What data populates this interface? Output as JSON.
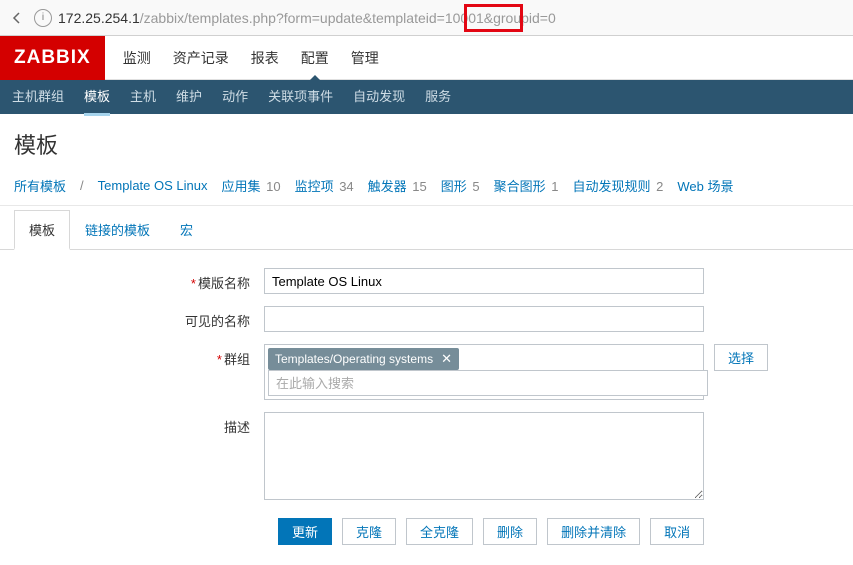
{
  "url": {
    "host": "172.25.254.1",
    "path": "/zabbix/templates.php?form=update&templateid=10001&groupid=0"
  },
  "logo": "ZABBIX",
  "topnav": [
    "监测",
    "资产记录",
    "报表",
    "配置",
    "管理"
  ],
  "topnav_active": 3,
  "subnav": [
    "主机群组",
    "模板",
    "主机",
    "维护",
    "动作",
    "关联项事件",
    "自动发现",
    "服务"
  ],
  "subnav_active": 1,
  "page_title": "模板",
  "filter": {
    "all_label": "所有模板",
    "current": "Template OS Linux",
    "items": [
      {
        "label": "应用集",
        "count": 10
      },
      {
        "label": "监控项",
        "count": 34
      },
      {
        "label": "触发器",
        "count": 15
      },
      {
        "label": "图形",
        "count": 5
      },
      {
        "label": "聚合图形",
        "count": 1
      },
      {
        "label": "自动发现规则",
        "count": 2
      },
      {
        "label": "Web 场景",
        "count": ""
      }
    ]
  },
  "tabs": [
    "模板",
    "链接的模板",
    "宏"
  ],
  "tabs_active": 0,
  "form": {
    "name_label": "模版名称",
    "name_value": "Template OS Linux",
    "visible_label": "可见的名称",
    "visible_value": "",
    "groups_label": "群组",
    "groups_chip": "Templates/Operating systems",
    "groups_placeholder": "在此输入搜索",
    "select_btn": "选择",
    "desc_label": "描述",
    "desc_value": ""
  },
  "buttons": {
    "update": "更新",
    "clone": "克隆",
    "fullclone": "全克隆",
    "delete": "删除",
    "delclear": "删除并清除",
    "cancel": "取消"
  }
}
